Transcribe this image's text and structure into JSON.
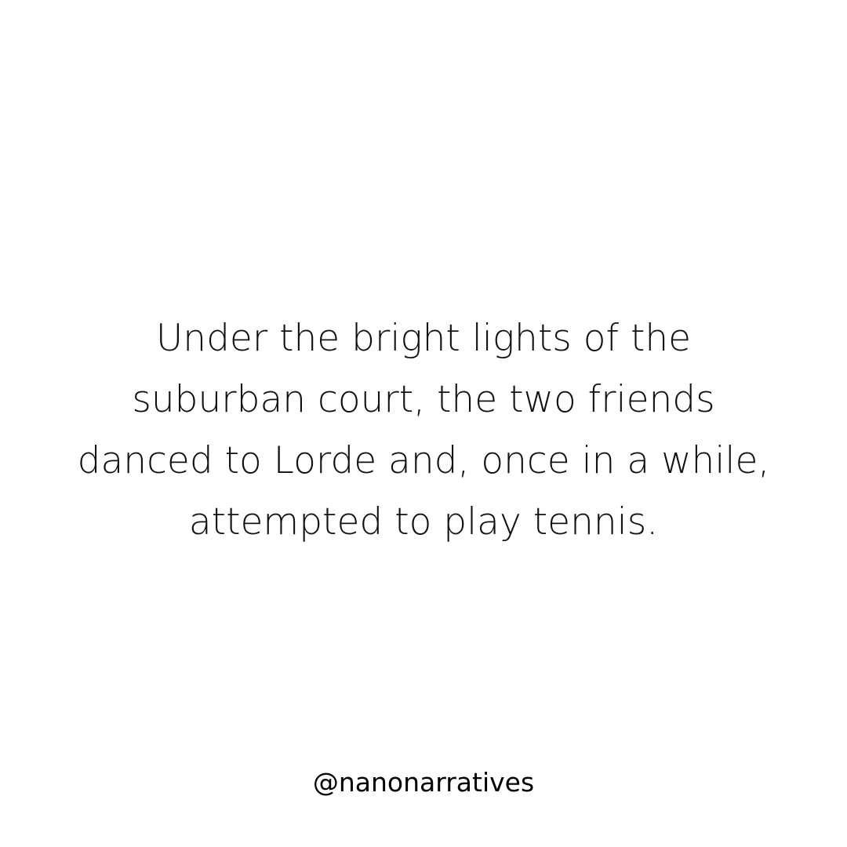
{
  "quote": {
    "lines": [
      "Under the bright lights of the",
      "suburban court, the two friends",
      "danced to Lorde and, once in a while,",
      "attempted to play tennis."
    ]
  },
  "footer": {
    "handle": "@nanonarratives"
  }
}
